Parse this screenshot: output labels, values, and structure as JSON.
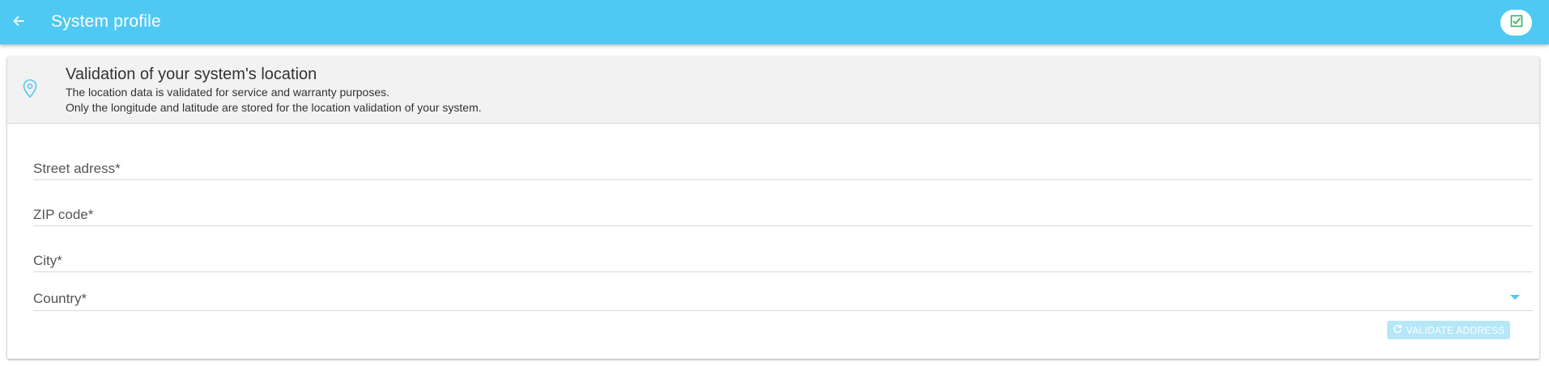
{
  "appbar": {
    "title": "System profile",
    "back_icon": "arrow-left-icon",
    "save_icon": "checkbox-checked-icon",
    "background": "#4fc9f4"
  },
  "location_card": {
    "icon": "map-pin-icon",
    "title": "Validation of your system's location",
    "description_line1": "The location data is validated for service and warranty purposes.",
    "description_line2": "Only the longitude and latitude are stored for the location validation of your system."
  },
  "form": {
    "street_label": "Street adress*",
    "street_value": "",
    "zip_label": "ZIP code*",
    "zip_value": "",
    "city_label": "City*",
    "city_value": "",
    "country_label": "Country*",
    "country_value": "",
    "validate_label": "VALIDATE ADDRESS",
    "validate_enabled": false,
    "accent": "#4fc9f4"
  }
}
